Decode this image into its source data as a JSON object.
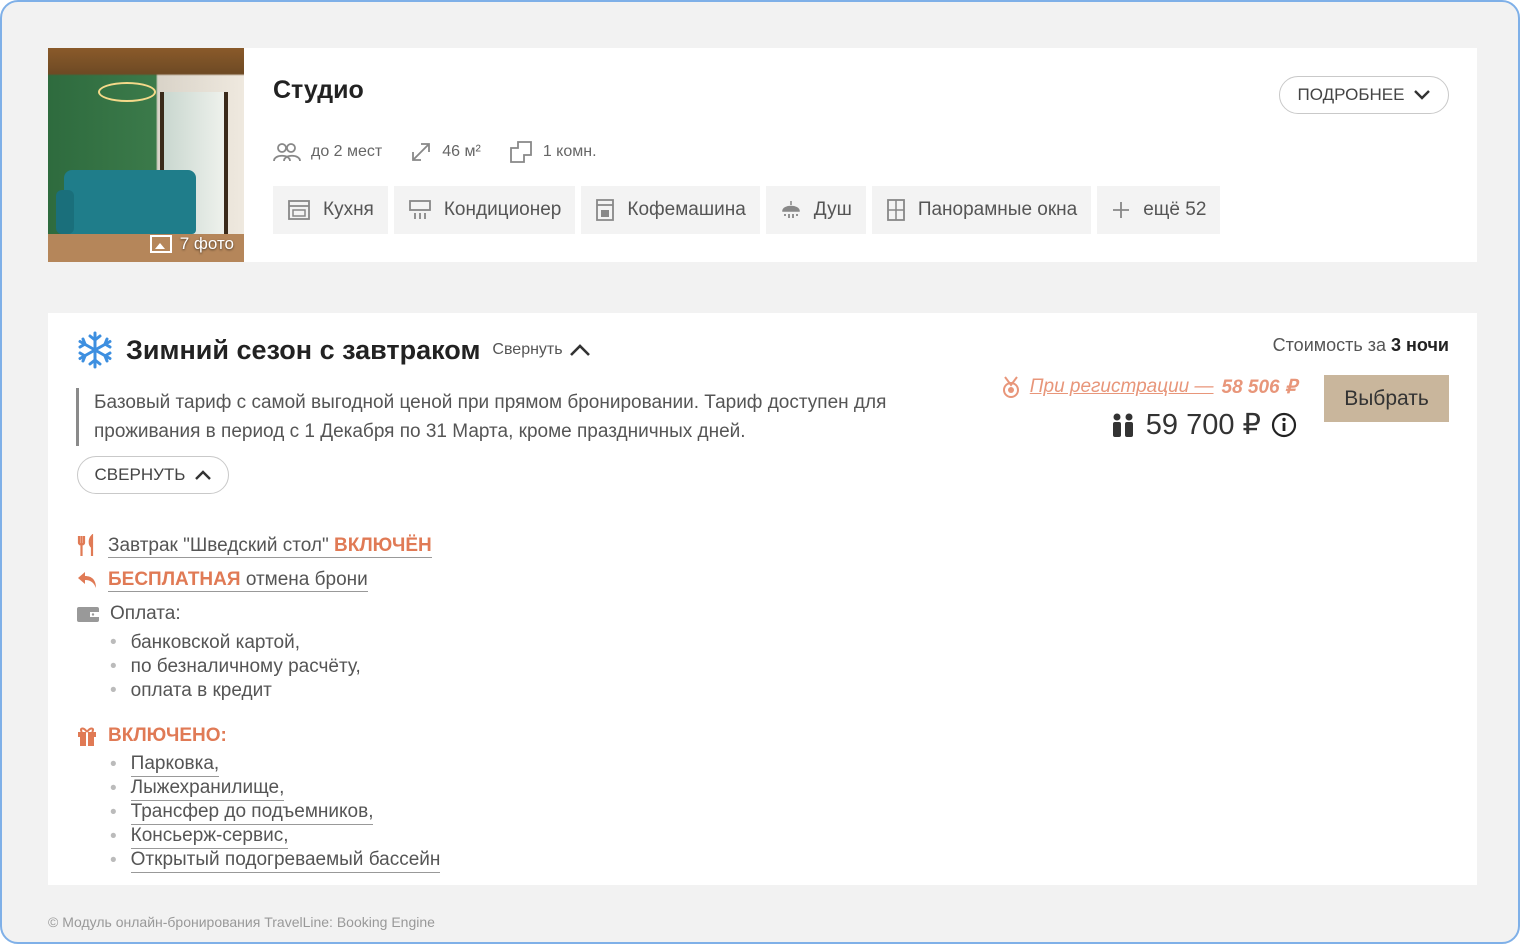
{
  "room": {
    "title": "Студио",
    "photo_count": "7 фото",
    "details_button": "ПОДРОБНЕЕ",
    "specs": {
      "capacity": "до 2 мест",
      "area": "46 м²",
      "rooms": "1 комн."
    },
    "amenities": [
      {
        "label": "Кухня",
        "icon": "kitchen-icon"
      },
      {
        "label": "Кондиционер",
        "icon": "air-conditioner-icon"
      },
      {
        "label": "Кофемашина",
        "icon": "coffee-machine-icon"
      },
      {
        "label": "Душ",
        "icon": "shower-icon"
      },
      {
        "label": "Панорамные окна",
        "icon": "window-icon"
      },
      {
        "label": "ещё 52",
        "icon": "plus-icon"
      }
    ]
  },
  "tariff": {
    "title": "Зимний сезон с завтраком",
    "collapse_link": "Свернуть",
    "description": "Базовый тариф с самой выгодной ценой при прямом бронировании. Тариф доступен для проживания в период с 1 Декабря по 31 Марта, кроме праздничных дней.",
    "collapse_button": "СВЕРНУТЬ",
    "price_label_prefix": "Стоимость за",
    "price_label_nights": "3 ночи",
    "registration_text": "При регистрации —",
    "registration_price": "58 506 ₽",
    "price": "59 700 ₽",
    "select_button": "Выбрать",
    "breakfast_text": "Завтрак \"Шведский стол\"",
    "breakfast_status": "ВКЛЮЧЁН",
    "cancellation_accent": "БЕСПЛАТНАЯ",
    "cancellation_text": "отмена брони",
    "payment_label": "Оплата:",
    "payment_methods": [
      "банковской картой,",
      "по безналичному расчёту,",
      "оплата в кредит"
    ],
    "included_label": "ВКЛЮЧЕНО:",
    "included_items": [
      "Парковка,",
      "Лыжехранилище,",
      "Трансфер до подъемников,",
      "Консьерж-сервис,",
      "Открытый подогреваемый бассейн"
    ]
  },
  "footer": "© Модуль онлайн-бронирования TravelLine: Booking Engine",
  "colors": {
    "accent": "#e07a55",
    "select_button": "#c9b69c",
    "frame_border": "#7fb0e8",
    "snowflake": "#3d8fe0"
  }
}
